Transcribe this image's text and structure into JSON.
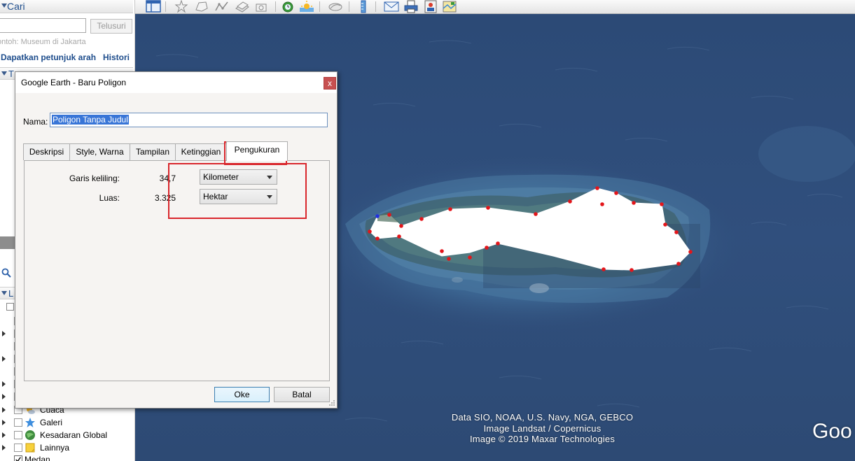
{
  "left_panel": {
    "search_title": "Cari",
    "search_button": "Telusuri",
    "search_placeholder": "ontoh: Museum di Jakarta",
    "directions_link": "Dapatkan petunjuk arah",
    "history_link": "Histori",
    "places_header": "T",
    "layers_header": "L",
    "layers": [
      {
        "label": "Cuaca",
        "icon": "sun-cloud-icon",
        "checked": false
      },
      {
        "label": "Galeri",
        "icon": "star-icon",
        "checked": false
      },
      {
        "label": "Kesadaran Global",
        "icon": "globe-icon",
        "checked": false
      },
      {
        "label": "Lainnya",
        "icon": "note-icon",
        "checked": false
      },
      {
        "label": "Medan",
        "icon": "",
        "checked": true
      }
    ]
  },
  "toolbar": {
    "buttons": [
      "sidebar-toggle-icon",
      "placemark-icon",
      "polygon-icon",
      "path-icon",
      "overlay-icon",
      "tour-icon",
      "historical-imagery-icon",
      "sunlight-icon",
      "planets-icon",
      "ruler-icon",
      "email-icon",
      "print-icon",
      "save-image-icon",
      "maps-icon"
    ]
  },
  "dialog": {
    "title": "Google Earth - Baru Poligon",
    "close": "x",
    "name_label": "Nama:",
    "name_value": "Poligon Tanpa Judul",
    "tabs": [
      "Deskripsi",
      "Style, Warna",
      "Tampilan",
      "Ketinggian",
      "Pengukuran"
    ],
    "active_tab": "Pengukuran",
    "perimeter_label": "Garis keliling:",
    "perimeter_value": "34,7",
    "perimeter_unit": "Kilometer",
    "area_label": "Luas:",
    "area_value": "3.325",
    "area_unit": "Hektar",
    "ok_button": "Oke",
    "cancel_button": "Batal"
  },
  "map": {
    "attribution": [
      "Data SIO, NOAA, U.S. Navy, NGA, GEBCO",
      "Image Landsat / Copernicus",
      "Image © 2019 Maxar Technologies"
    ],
    "brand": "Goo",
    "polygon_fill": "#ffffff",
    "vertex_color": "#e3161b",
    "start_vertex_color": "#2030e0"
  },
  "colors": {
    "annotation": "#d9262c",
    "ocean": "#2f4c78"
  }
}
